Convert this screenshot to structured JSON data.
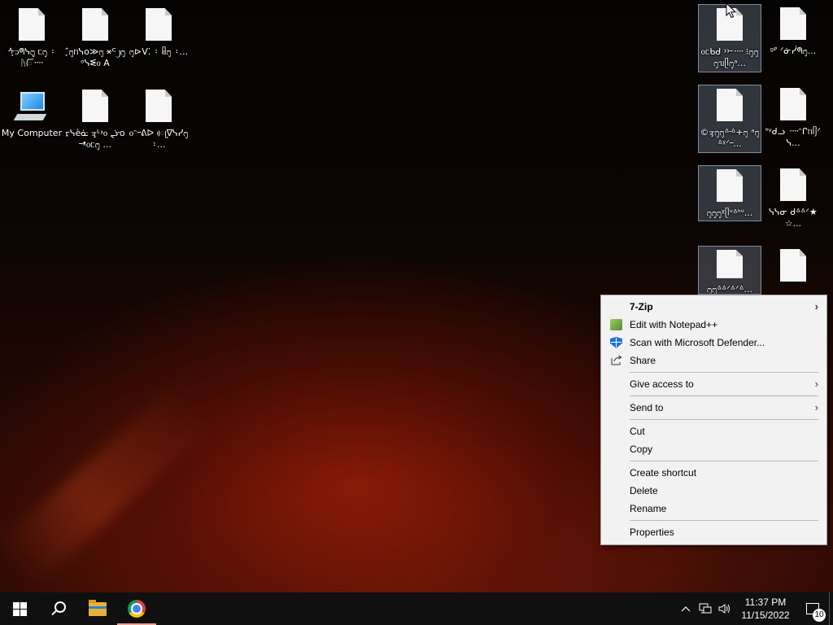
{
  "desktop": {
    "icons": [
      {
        "label": "ᠰ᜔᧑ᖗᓭ᧕᜔ ᥴ᧕ ᛬ ᚤᰩ᠁",
        "type": "file"
      },
      {
        "label": "ˆ᜔᧕ᥒᓭᴏ≫᧕ ᰾ᒼ᧒᧕ᵒᓭᓬ᧐ A",
        "type": "file"
      },
      {
        "label": "᧕⊳ᐯ⁚ ᛬ ᥤ᧕ ᛬...",
        "type": "file"
      },
      {
        "label": "My Computer",
        "type": "computer"
      },
      {
        "label": "ᠷᓭèᓎ ᢋᒻ᠈᧐ ᖣ᠊ᴏ᠆ᵜ᧐ᥴ᧕ ...",
        "type": "file"
      },
      {
        "label": "᧐ᵔ᠆ᕕᐅ ᰴᥧ∇ᓭᓯ᧕ ᛬...",
        "type": "file"
      },
      {
        "label": "᧐ᥴᑲᑯ ᠈᠈᠊᠊᠁ ⁝᧕᧕᧕ᥔᥫ᧕ᵃ...",
        "type": "file"
      },
      {
        "label": "ᵍᴾ ᐟᓃᓰᖗ᧕...",
        "type": "file"
      },
      {
        "label": "©ᢋ᧕᧕ᐞ᠊ᐞ+᧕ ᵃ᧕ᐞᵡᐟ᠆...",
        "type": "file"
      },
      {
        "label": "ᑋᵞᑯᓗ ᠁ᵔᒋᥒᥦᐟᓭ...",
        "type": "file"
      },
      {
        "label": "᧕᧕᧕ᵡᥫᐡᐞᑋᐡ...",
        "type": "file"
      },
      {
        "label": "ᓭᓭᓂ ᑯᐞᐞᐟ★☆...",
        "type": "file"
      },
      {
        "label": "᧕᧕ᐞᐞᐟᐞᐟᐞ...",
        "type": "file"
      },
      {
        "label": "",
        "type": "file"
      }
    ]
  },
  "context_menu": {
    "items": [
      {
        "label": "7-Zip",
        "bold": true,
        "submenu": true,
        "icon": ""
      },
      {
        "label": "Edit with Notepad++",
        "icon": "notepad-plus-plus-icon"
      },
      {
        "label": "Scan with Microsoft Defender...",
        "icon": "defender-shield-icon"
      },
      {
        "label": "Share",
        "icon": "share-icon"
      },
      {
        "label": "Give access to",
        "submenu": true
      },
      {
        "label": "Send to",
        "submenu": true
      },
      {
        "label": "Cut"
      },
      {
        "label": "Copy"
      },
      {
        "label": "Create shortcut"
      },
      {
        "label": "Delete"
      },
      {
        "label": "Rename"
      },
      {
        "label": "Properties"
      }
    ]
  },
  "taskbar": {
    "apps": [
      "start-button",
      "search-button",
      "file-explorer",
      "chrome"
    ],
    "clock": {
      "time": "11:37 PM",
      "date": "11/15/2022"
    },
    "notification_count": "10",
    "tray_glyphs": {
      "chevron": "^",
      "volume": "🔊"
    }
  }
}
